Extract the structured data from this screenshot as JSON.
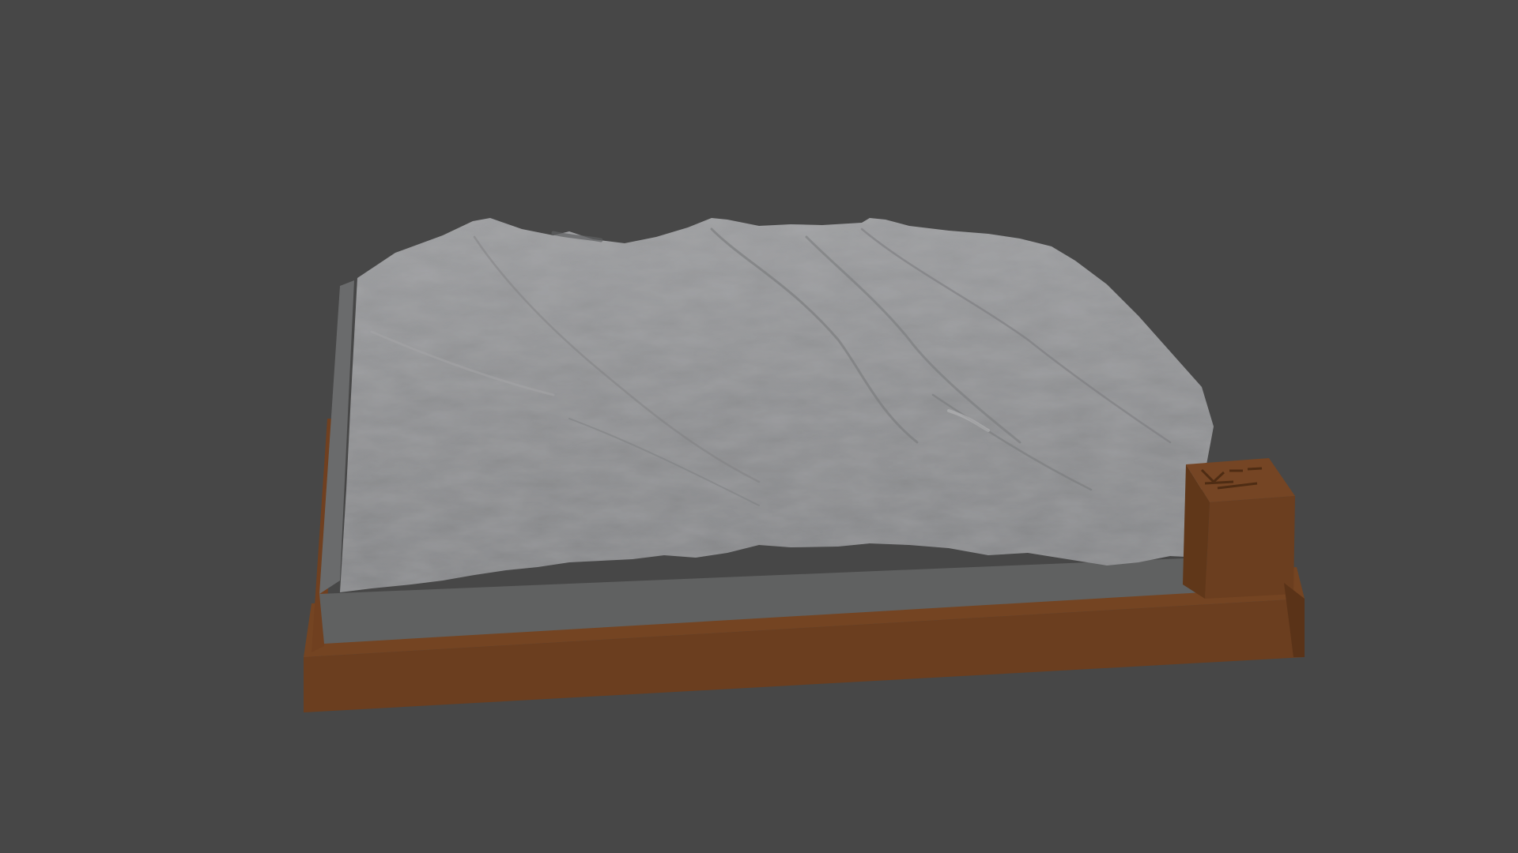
{
  "viewport": {
    "background_color": "#474747"
  },
  "model": {
    "subject": "terrain-relief-model",
    "terrain_color": "#8c8d8f",
    "terrain_side_color": "#606161",
    "base_color": "#6b3e1f",
    "base_shadow_color": "#5a3318",
    "label_block_color": "#6b3e1f"
  }
}
